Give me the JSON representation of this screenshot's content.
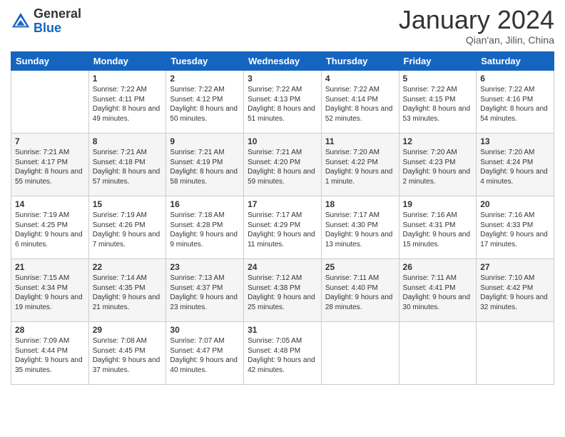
{
  "logo": {
    "general": "General",
    "blue": "Blue"
  },
  "title": "January 2024",
  "subtitle": "Qian'an, Jilin, China",
  "days_of_week": [
    "Sunday",
    "Monday",
    "Tuesday",
    "Wednesday",
    "Thursday",
    "Friday",
    "Saturday"
  ],
  "weeks": [
    [
      {
        "day": "",
        "sunrise": "",
        "sunset": "",
        "daylight": ""
      },
      {
        "day": "1",
        "sunrise": "Sunrise: 7:22 AM",
        "sunset": "Sunset: 4:11 PM",
        "daylight": "Daylight: 8 hours and 49 minutes."
      },
      {
        "day": "2",
        "sunrise": "Sunrise: 7:22 AM",
        "sunset": "Sunset: 4:12 PM",
        "daylight": "Daylight: 8 hours and 50 minutes."
      },
      {
        "day": "3",
        "sunrise": "Sunrise: 7:22 AM",
        "sunset": "Sunset: 4:13 PM",
        "daylight": "Daylight: 8 hours and 51 minutes."
      },
      {
        "day": "4",
        "sunrise": "Sunrise: 7:22 AM",
        "sunset": "Sunset: 4:14 PM",
        "daylight": "Daylight: 8 hours and 52 minutes."
      },
      {
        "day": "5",
        "sunrise": "Sunrise: 7:22 AM",
        "sunset": "Sunset: 4:15 PM",
        "daylight": "Daylight: 8 hours and 53 minutes."
      },
      {
        "day": "6",
        "sunrise": "Sunrise: 7:22 AM",
        "sunset": "Sunset: 4:16 PM",
        "daylight": "Daylight: 8 hours and 54 minutes."
      }
    ],
    [
      {
        "day": "7",
        "sunrise": "Sunrise: 7:21 AM",
        "sunset": "Sunset: 4:17 PM",
        "daylight": "Daylight: 8 hours and 55 minutes."
      },
      {
        "day": "8",
        "sunrise": "Sunrise: 7:21 AM",
        "sunset": "Sunset: 4:18 PM",
        "daylight": "Daylight: 8 hours and 57 minutes."
      },
      {
        "day": "9",
        "sunrise": "Sunrise: 7:21 AM",
        "sunset": "Sunset: 4:19 PM",
        "daylight": "Daylight: 8 hours and 58 minutes."
      },
      {
        "day": "10",
        "sunrise": "Sunrise: 7:21 AM",
        "sunset": "Sunset: 4:20 PM",
        "daylight": "Daylight: 8 hours and 59 minutes."
      },
      {
        "day": "11",
        "sunrise": "Sunrise: 7:20 AM",
        "sunset": "Sunset: 4:22 PM",
        "daylight": "Daylight: 9 hours and 1 minute."
      },
      {
        "day": "12",
        "sunrise": "Sunrise: 7:20 AM",
        "sunset": "Sunset: 4:23 PM",
        "daylight": "Daylight: 9 hours and 2 minutes."
      },
      {
        "day": "13",
        "sunrise": "Sunrise: 7:20 AM",
        "sunset": "Sunset: 4:24 PM",
        "daylight": "Daylight: 9 hours and 4 minutes."
      }
    ],
    [
      {
        "day": "14",
        "sunrise": "Sunrise: 7:19 AM",
        "sunset": "Sunset: 4:25 PM",
        "daylight": "Daylight: 9 hours and 6 minutes."
      },
      {
        "day": "15",
        "sunrise": "Sunrise: 7:19 AM",
        "sunset": "Sunset: 4:26 PM",
        "daylight": "Daylight: 9 hours and 7 minutes."
      },
      {
        "day": "16",
        "sunrise": "Sunrise: 7:18 AM",
        "sunset": "Sunset: 4:28 PM",
        "daylight": "Daylight: 9 hours and 9 minutes."
      },
      {
        "day": "17",
        "sunrise": "Sunrise: 7:17 AM",
        "sunset": "Sunset: 4:29 PM",
        "daylight": "Daylight: 9 hours and 11 minutes."
      },
      {
        "day": "18",
        "sunrise": "Sunrise: 7:17 AM",
        "sunset": "Sunset: 4:30 PM",
        "daylight": "Daylight: 9 hours and 13 minutes."
      },
      {
        "day": "19",
        "sunrise": "Sunrise: 7:16 AM",
        "sunset": "Sunset: 4:31 PM",
        "daylight": "Daylight: 9 hours and 15 minutes."
      },
      {
        "day": "20",
        "sunrise": "Sunrise: 7:16 AM",
        "sunset": "Sunset: 4:33 PM",
        "daylight": "Daylight: 9 hours and 17 minutes."
      }
    ],
    [
      {
        "day": "21",
        "sunrise": "Sunrise: 7:15 AM",
        "sunset": "Sunset: 4:34 PM",
        "daylight": "Daylight: 9 hours and 19 minutes."
      },
      {
        "day": "22",
        "sunrise": "Sunrise: 7:14 AM",
        "sunset": "Sunset: 4:35 PM",
        "daylight": "Daylight: 9 hours and 21 minutes."
      },
      {
        "day": "23",
        "sunrise": "Sunrise: 7:13 AM",
        "sunset": "Sunset: 4:37 PM",
        "daylight": "Daylight: 9 hours and 23 minutes."
      },
      {
        "day": "24",
        "sunrise": "Sunrise: 7:12 AM",
        "sunset": "Sunset: 4:38 PM",
        "daylight": "Daylight: 9 hours and 25 minutes."
      },
      {
        "day": "25",
        "sunrise": "Sunrise: 7:11 AM",
        "sunset": "Sunset: 4:40 PM",
        "daylight": "Daylight: 9 hours and 28 minutes."
      },
      {
        "day": "26",
        "sunrise": "Sunrise: 7:11 AM",
        "sunset": "Sunset: 4:41 PM",
        "daylight": "Daylight: 9 hours and 30 minutes."
      },
      {
        "day": "27",
        "sunrise": "Sunrise: 7:10 AM",
        "sunset": "Sunset: 4:42 PM",
        "daylight": "Daylight: 9 hours and 32 minutes."
      }
    ],
    [
      {
        "day": "28",
        "sunrise": "Sunrise: 7:09 AM",
        "sunset": "Sunset: 4:44 PM",
        "daylight": "Daylight: 9 hours and 35 minutes."
      },
      {
        "day": "29",
        "sunrise": "Sunrise: 7:08 AM",
        "sunset": "Sunset: 4:45 PM",
        "daylight": "Daylight: 9 hours and 37 minutes."
      },
      {
        "day": "30",
        "sunrise": "Sunrise: 7:07 AM",
        "sunset": "Sunset: 4:47 PM",
        "daylight": "Daylight: 9 hours and 40 minutes."
      },
      {
        "day": "31",
        "sunrise": "Sunrise: 7:05 AM",
        "sunset": "Sunset: 4:48 PM",
        "daylight": "Daylight: 9 hours and 42 minutes."
      },
      {
        "day": "",
        "sunrise": "",
        "sunset": "",
        "daylight": ""
      },
      {
        "day": "",
        "sunrise": "",
        "sunset": "",
        "daylight": ""
      },
      {
        "day": "",
        "sunrise": "",
        "sunset": "",
        "daylight": ""
      }
    ]
  ]
}
